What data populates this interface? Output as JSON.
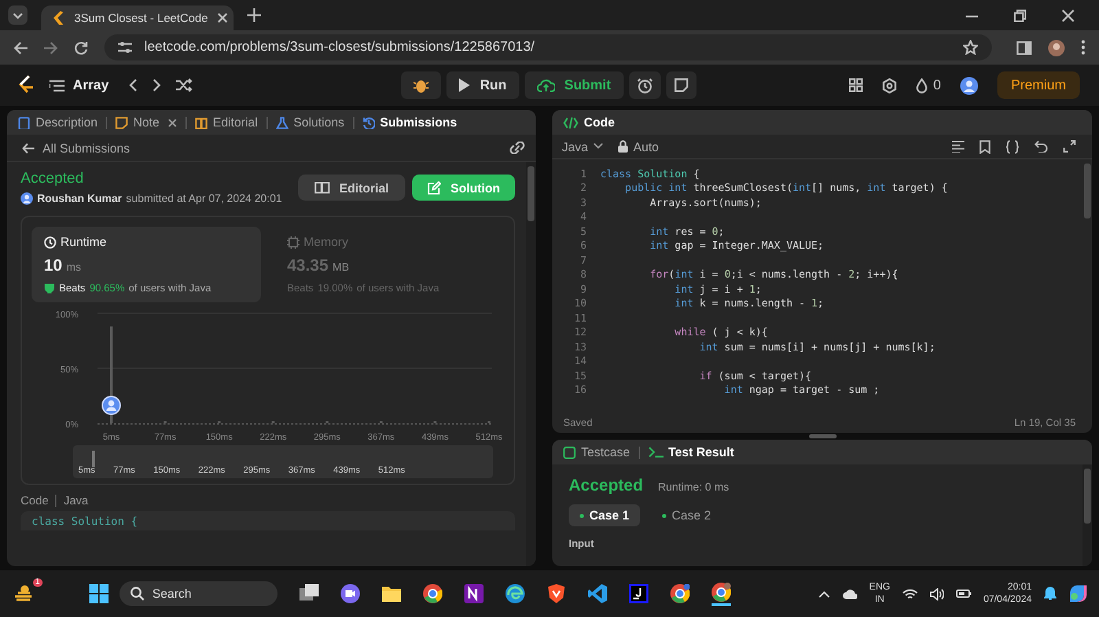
{
  "browser": {
    "tab_title": "3Sum Closest - LeetCode",
    "url": "leetcode.com/problems/3sum-closest/submissions/1225867013/"
  },
  "nav": {
    "problem_list": "Array",
    "run": "Run",
    "submit": "Submit",
    "streak": "0",
    "premium": "Premium"
  },
  "left_panel": {
    "tabs": [
      {
        "label": "Description",
        "selected": false,
        "kind": "doc"
      },
      {
        "label": "Note",
        "selected": false,
        "kind": "note"
      },
      {
        "label": "Editorial",
        "selected": false,
        "kind": "book"
      },
      {
        "label": "Solutions",
        "selected": false,
        "kind": "flask"
      },
      {
        "label": "Submissions",
        "selected": true,
        "kind": "history"
      }
    ],
    "back_label": "All Submissions",
    "status": "Accepted",
    "author": "Roushan Kumar",
    "submitted": "submitted at Apr 07, 2024 20:01",
    "buttons": [
      {
        "label": "Editorial",
        "kind": "secondary"
      },
      {
        "label": "Solution",
        "kind": "primary"
      }
    ],
    "metrics": [
      {
        "label": "Runtime",
        "value": "10",
        "unit": "ms",
        "beats": "Beats",
        "percent": "90.65%",
        "suffix": "of users with Java",
        "selected": true,
        "kind": "clock"
      },
      {
        "label": "Memory",
        "value": "43.35",
        "unit": "MB",
        "beats": "Beats",
        "percent": "19.00%",
        "suffix": "of users with Java",
        "selected": false,
        "kind": "chip"
      }
    ],
    "chart_data": {
      "type": "bar",
      "categories": [
        "5ms",
        "77ms",
        "150ms",
        "222ms",
        "295ms",
        "367ms",
        "439ms",
        "512ms"
      ],
      "series": [
        {
          "color": "#5a5a5a",
          "values": [
            88,
            0,
            0,
            0,
            0,
            0,
            0,
            0
          ]
        }
      ],
      "ylim": [
        0,
        100
      ],
      "yticks": [
        {
          "value": 0,
          "label": "0%"
        },
        {
          "value": 50,
          "label": "50%"
        },
        {
          "value": 100,
          "label": "100%"
        }
      ]
    },
    "overview_labels": [
      "5ms",
      "77ms",
      "150ms",
      "222ms",
      "295ms",
      "367ms",
      "439ms",
      "512ms"
    ],
    "code_label": "Code",
    "code_language": "Java",
    "preview_code": "class Solution {"
  },
  "editor": {
    "title": "Code",
    "language": "Java",
    "mode": "Auto",
    "status": "Saved",
    "cursor": "Ln 19, Col 35",
    "lines": [
      {
        "no": "1",
        "segments": [
          {
            "text": "class ",
            "kind": "kw"
          },
          {
            "text": "Solution",
            "kind": "type"
          },
          {
            "text": " {",
            "kind": "plain"
          }
        ]
      },
      {
        "no": "2",
        "segments": [
          {
            "text": "    public int ",
            "kind": "kw"
          },
          {
            "text": "threeSumClosest(",
            "kind": "plain"
          },
          {
            "text": "int",
            "kind": "kw"
          },
          {
            "text": "[] nums, ",
            "kind": "plain"
          },
          {
            "text": "int",
            "kind": "kw"
          },
          {
            "text": " target) {",
            "kind": "plain"
          }
        ]
      },
      {
        "no": "3",
        "segments": [
          {
            "text": "        Arrays.sort(nums);",
            "kind": "plain"
          }
        ]
      },
      {
        "no": "4"
      },
      {
        "no": "5",
        "segments": [
          {
            "text": "        int",
            "kind": "kw"
          },
          {
            "text": " res = ",
            "kind": "plain"
          },
          {
            "text": "0",
            "kind": "num"
          },
          {
            "text": ";",
            "kind": "plain"
          }
        ]
      },
      {
        "no": "6",
        "segments": [
          {
            "text": "        int",
            "kind": "kw"
          },
          {
            "text": " gap = Integer.MAX_VALUE;",
            "kind": "plain"
          }
        ]
      },
      {
        "no": "7"
      },
      {
        "no": "8",
        "segments": [
          {
            "text": "        for",
            "kind": "ctl"
          },
          {
            "text": "(",
            "kind": "plain"
          },
          {
            "text": "int",
            "kind": "kw"
          },
          {
            "text": " i = ",
            "kind": "plain"
          },
          {
            "text": "0",
            "kind": "num"
          },
          {
            "text": ";i < nums.length - ",
            "kind": "plain"
          },
          {
            "text": "2",
            "kind": "num"
          },
          {
            "text": "; i++){",
            "kind": "plain"
          }
        ]
      },
      {
        "no": "9",
        "segments": [
          {
            "text": "            int",
            "kind": "kw"
          },
          {
            "text": " j = i + ",
            "kind": "plain"
          },
          {
            "text": "1",
            "kind": "num"
          },
          {
            "text": ";",
            "kind": "plain"
          }
        ]
      },
      {
        "no": "10",
        "segments": [
          {
            "text": "            int",
            "kind": "kw"
          },
          {
            "text": " k = nums.length - ",
            "kind": "plain"
          },
          {
            "text": "1",
            "kind": "num"
          },
          {
            "text": ";",
            "kind": "plain"
          }
        ]
      },
      {
        "no": "11"
      },
      {
        "no": "12",
        "segments": [
          {
            "text": "            while",
            "kind": "ctl"
          },
          {
            "text": " ( j < k){",
            "kind": "plain"
          }
        ]
      },
      {
        "no": "13",
        "segments": [
          {
            "text": "                int",
            "kind": "kw"
          },
          {
            "text": " sum = nums[i] + nums[j] + nums[k];",
            "kind": "plain"
          }
        ]
      },
      {
        "no": "14"
      },
      {
        "no": "15",
        "segments": [
          {
            "text": "                if",
            "kind": "ctl"
          },
          {
            "text": " (sum < target){",
            "kind": "plain"
          }
        ]
      },
      {
        "no": "16",
        "segments": [
          {
            "text": "                    int",
            "kind": "kw"
          },
          {
            "text": " ngap = target - sum ;",
            "kind": "plain"
          }
        ]
      }
    ]
  },
  "result": {
    "tabs": [
      {
        "label": "Testcase",
        "selected": false,
        "kind": "check"
      },
      {
        "label": "Test Result",
        "selected": true,
        "kind": "terminal"
      }
    ],
    "status": "Accepted",
    "runtime": "Runtime: 0 ms",
    "cases": [
      {
        "label": "Case 1",
        "selected": true
      },
      {
        "label": "Case 2",
        "selected": false
      }
    ],
    "input_label": "Input"
  },
  "taskbar": {
    "badge": "1",
    "search_placeholder": "Search",
    "language": "ENG",
    "region": "IN",
    "time": "20:01",
    "date": "07/04/2024"
  }
}
